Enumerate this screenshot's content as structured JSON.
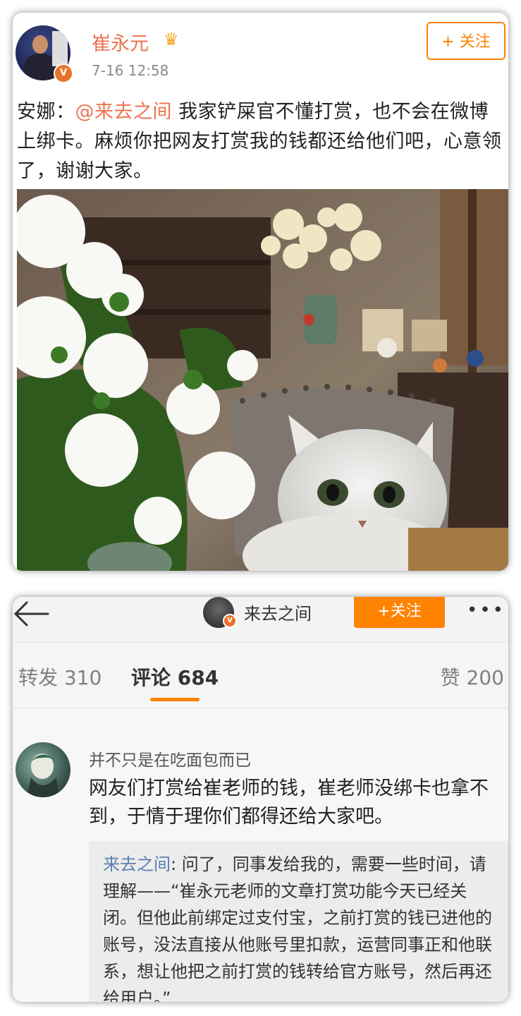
{
  "post": {
    "author": "崔永元",
    "time": "7-16 12:58",
    "follow_label": "+ 关注",
    "text_prefix": "安娜：",
    "mention": "@来去之间",
    "text_body": " 我家铲屎官不懂打赏，也不会在微博上绑卡。麻烦你把网友打赏我的钱都还给他们吧，心意领了，谢谢大家。"
  },
  "detail": {
    "nickname": "来去之间",
    "follow_label": "+关注",
    "more_label": "•••",
    "tabs": [
      {
        "label": "转发 310"
      },
      {
        "label": "评论 684"
      },
      {
        "label": "赞 200"
      }
    ],
    "comment": {
      "author": "并不只是在吃面包而已",
      "text": "网友们打赏给崔老师的钱，崔老师没绑卡也拿不到，于情于理你们都得还给大家吧。",
      "reply_author": "来去之间",
      "reply_text": ": 问了，同事发给我的，需要一些时间，请理解——“崔永元老师的文章打赏功能今天已经关闭。但他此前绑定过支付宝，之前打赏的钱已进他的账号，没法直接从他账号里扣款，运营同事正和他联系，想让他把之前打赏的钱转给官方账号，然后再还给用户。”"
    }
  },
  "colors": {
    "accent": "#ff8200",
    "author_name": "#eb7350",
    "link_blue": "#5b7fb0"
  }
}
